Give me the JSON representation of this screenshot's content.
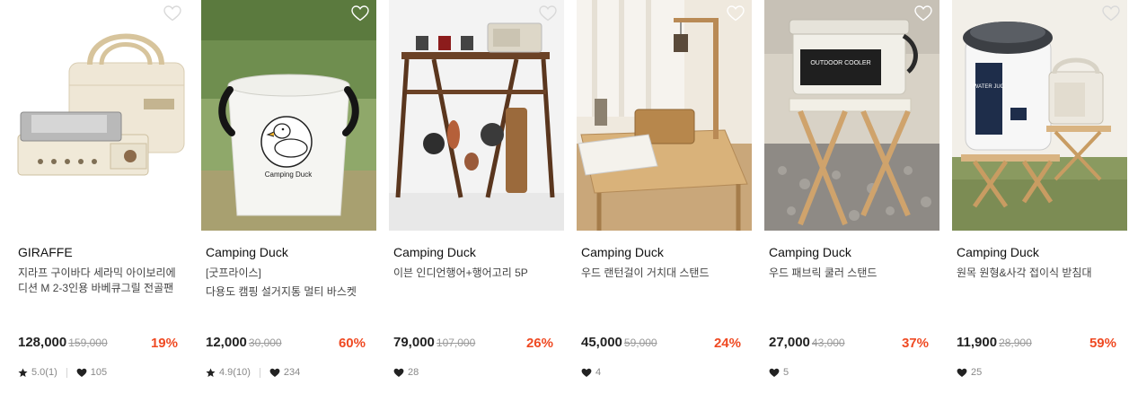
{
  "colors": {
    "discount": "#ef4a23",
    "price": "#222222",
    "muted": "#9a9a9a"
  },
  "products": [
    {
      "brand": "GIRAFFE",
      "title_line1": "지라프 구이바다 세라믹 아이보리에",
      "title_line2": "디션 M 2-3인용 바베큐그릴 전골팬",
      "price": "128,000",
      "original_price": "159,000",
      "discount": "19%",
      "rating": "5.0(1)",
      "likes": "105",
      "wish_icon": "heart-outline-icon"
    },
    {
      "brand": "Camping Duck",
      "title_line1": "[굿프라이스]",
      "title_line2": "다용도 캠핑 설거지통 멀티 바스켓",
      "price": "12,000",
      "original_price": "30,000",
      "discount": "60%",
      "rating": "4.9(10)",
      "likes": "234",
      "wish_icon": "heart-outline-icon"
    },
    {
      "brand": "Camping Duck",
      "title_line1": "이븐 인디언행어+행어고리 5P",
      "title_line2": "",
      "price": "79,000",
      "original_price": "107,000",
      "discount": "26%",
      "rating": "",
      "likes": "28",
      "wish_icon": "heart-outline-icon"
    },
    {
      "brand": "Camping Duck",
      "title_line1": "우드 랜턴걸이 거치대 스탠드",
      "title_line2": "",
      "price": "45,000",
      "original_price": "59,000",
      "discount": "24%",
      "rating": "",
      "likes": "4",
      "wish_icon": "heart-outline-icon"
    },
    {
      "brand": "Camping Duck",
      "title_line1": "우드 패브릭 쿨러 스탠드",
      "title_line2": "",
      "price": "27,000",
      "original_price": "43,000",
      "discount": "37%",
      "rating": "",
      "likes": "5",
      "wish_icon": "heart-outline-icon"
    },
    {
      "brand": "Camping Duck",
      "title_line1": "원목 원형&사각 접이식 받침대",
      "title_line2": "",
      "price": "11,900",
      "original_price": "28,900",
      "discount": "59%",
      "rating": "",
      "likes": "25",
      "wish_icon": "heart-outline-icon"
    }
  ],
  "product_images": [
    {
      "alt": "grill-and-bag-photo",
      "print": ""
    },
    {
      "alt": "duck-basket-photo",
      "print": "Camping Duck"
    },
    {
      "alt": "hanger-rack-photo",
      "print": ""
    },
    {
      "alt": "lantern-stand-photo",
      "print": ""
    },
    {
      "alt": "cooler-stand-photo",
      "print": "OUTDOOR COOLER"
    },
    {
      "alt": "water-jug-stand-photo",
      "print": "WATER JUG"
    }
  ]
}
